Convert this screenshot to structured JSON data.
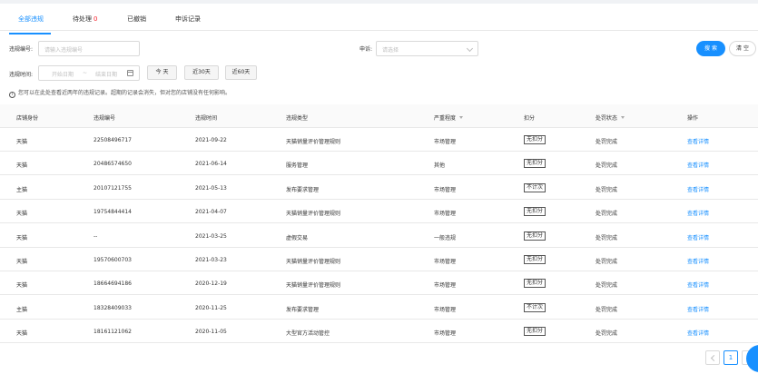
{
  "tabs": [
    {
      "label": "全部违规",
      "active": true
    },
    {
      "label": "待处理",
      "badge": "0"
    },
    {
      "label": "已撤销"
    },
    {
      "label": "申诉记录"
    }
  ],
  "filters": {
    "violation_no_label": "违规编号:",
    "violation_no_placeholder": "请输入违规编号",
    "appeal_label": "申诉:",
    "appeal_placeholder": "请选择",
    "time_label": "违规时间:",
    "start_placeholder": "开始日期",
    "range_sep": "~",
    "end_placeholder": "结束日期",
    "quick": [
      "今 天",
      "近30天",
      "近60天"
    ],
    "search_label": "搜 索",
    "clear_label": "清 空"
  },
  "tip": "您可以在此处查看近两年的违规记录。超期的记录会消失，但对您的店铺没有任何影响。",
  "table": {
    "columns": [
      "店铺身份",
      "违规编号",
      "违规时间",
      "违规类型",
      "严重程度",
      "扣分",
      "处罚状态",
      "操作"
    ],
    "rows": [
      [
        "天猫",
        "22508496717",
        "2021-09-22",
        "天猫销量评价管理规则",
        "市场管理",
        "无扣分",
        "处罚完成",
        "查看详情"
      ],
      [
        "天猫",
        "20486574650",
        "2021-06-14",
        "服务管理",
        "其他",
        "无扣分",
        "处罚完成",
        "查看详情"
      ],
      [
        "主猫",
        "20107121755",
        "2021-05-13",
        "发布要求管理",
        "市场管理",
        "不计次",
        "处罚完成",
        "查看详情"
      ],
      [
        "天猫",
        "19754844414",
        "2021-04-07",
        "天猫销量评价管理规则",
        "市场管理",
        "无扣分",
        "处罚完成",
        "查看详情"
      ],
      [
        "天猫",
        "--",
        "2021-03-25",
        "虚假交易",
        "一般违规",
        "无扣分",
        "处罚完成",
        "查看详情"
      ],
      [
        "天猫",
        "19570600703",
        "2021-03-23",
        "天猫销量评价管理规则",
        "市场管理",
        "无扣分",
        "处罚完成",
        "查看详情"
      ],
      [
        "天猫",
        "18664694186",
        "2020-12-19",
        "天猫销量评价管理规则",
        "市场管理",
        "无扣分",
        "处罚完成",
        "查看详情"
      ],
      [
        "主猫",
        "18328409033",
        "2020-11-25",
        "发布要求管理",
        "市场管理",
        "不计次",
        "处罚完成",
        "查看详情"
      ],
      [
        "天猫",
        "18161121062",
        "2020-11-05",
        "大型官方活动管控",
        "市场管理",
        "无扣分",
        "处罚完成",
        "查看详情"
      ]
    ]
  },
  "pagination": {
    "current": "1"
  },
  "colors": {
    "primary": "#1890ff",
    "badge": "#f5222d"
  }
}
